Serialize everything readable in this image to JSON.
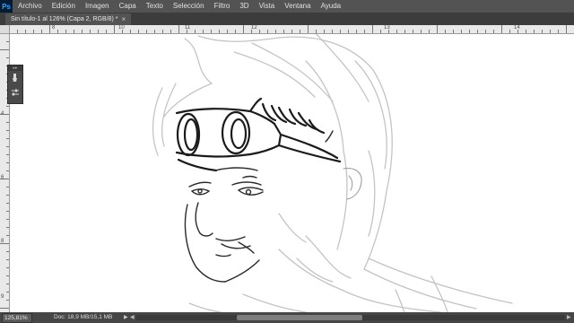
{
  "app": {
    "logo": "Ps"
  },
  "menu": [
    "Archivo",
    "Edición",
    "Imagen",
    "Capa",
    "Texto",
    "Selección",
    "Filtro",
    "3D",
    "Vista",
    "Ventana",
    "Ayuda"
  ],
  "tab": {
    "title": "Sin título-1 al 126% (Capa 2, RGB/8) *",
    "close": "×"
  },
  "ruler_h": [
    "8",
    "10",
    "11",
    "12",
    "13",
    "14"
  ],
  "ruler_v": [
    "4",
    "6",
    "8",
    "9"
  ],
  "panel": {
    "grip": "▸▸",
    "tools": [
      "brush-tool-icon",
      "adjust-sliders-icon"
    ]
  },
  "status": {
    "zoom": "125,81%",
    "doc": "Doc: 18,9 MB/15,1 MB",
    "arrow": "▶",
    "scroll_left": "◀",
    "scroll_right": "▶",
    "scroll_position": 0.33
  },
  "colors": {
    "chrome": "#535353",
    "tabbar": "#3c3c3c",
    "logo_bg": "#001d34",
    "logo_fg": "#31a8ff",
    "sketch_dark": "#1b1b1b",
    "sketch_light": "#c4c4c4"
  }
}
